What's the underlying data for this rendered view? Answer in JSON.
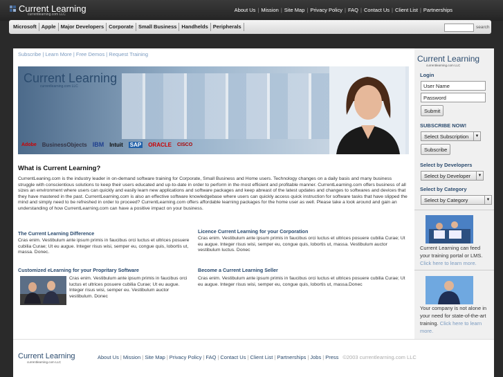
{
  "brand": {
    "name": "Current Learning",
    "sub": "currentlearning.com LLC"
  },
  "top_nav": [
    "About Us",
    "Mission",
    "Site Map",
    "Privacy Policy",
    "FAQ",
    "Contact Us",
    "Client List",
    "Partnerships"
  ],
  "menu": [
    "Microsoft",
    "Apple",
    "Major Developers",
    "Corporate",
    "Small Business",
    "Handhelds",
    "Peripherals"
  ],
  "search": {
    "button": "search"
  },
  "subnav": "Subscribe | Learn More | Free Demos | Request Training",
  "partners": [
    "Adobe",
    "BusinessObjects",
    "IBM",
    "Intuit",
    "SAP",
    "ORACLE",
    "CISCO"
  ],
  "main": {
    "heading": "What is Current Learning?",
    "intro": "CurrentLeaning.com is the industry leader in on-demand software training for Corporate, Small Business and Home users. Technology changes on a daily basis and many business struggle with conscientious solutions to keep their users educated and up-to-date in order to perform in the most efficient and profitable manner. CurrentLearning.com offers business of all sizes an environment where users can quickly and easily learn new applications and software packages and keep abreast of the latest updates and changes to softwares and devices that they have mastered in the past. CurrentLearning.com is also an effective software knowledgebase where users can quickly access quick instruction for software tasks that have slipped the mind and simply need to be refreshed in order to proceed? CurrentLearning.com offers affordable learning packages for the home user as well. Please take a look around and gain an understanding of how CurrentLearning.com can have a positive impact on your business.",
    "sections": [
      {
        "title": "The Current Learning Difference",
        "body": "Cras enim. Vestibulum ante ipsum primis in faucibus orci luctus et ultrices posuere cubilia Curae; Ut eu augue. Integer risus wisi, semper eu, congue quis, lobortis ut, massa. Donec."
      },
      {
        "title": "Licence Current Learning for your Corporation",
        "body": "Cras enim. Vestibulum ante ipsum primis in faucibus orci luctus et ultrices posuere cubilia Curae; Ut eu augue. Integer risus wisi, semper eu, congue quis, lobortis ut, massa. Vestibulum auctor vestibulum luctus. Donec"
      },
      {
        "title": "Customized eLearning for your Propritary Software",
        "body": "Cras enim. Vestibulum ante ipsum primis in faucibus orci luctus et ultrices posuere cubilia Curae; Ut eu augue. Integer risus wisi, semper eu. Vestibulum auctor vestibulum. Donec"
      },
      {
        "title": "Become a Current Learning Seller",
        "body": "Cras enim. Vestibulum ante ipsum primis in faucibus orci luctus et ultrices posuere cubilia Curae; Ut eu augue. Integer risus wisi, semper eu, congue quis, lobortis ut, massa.Donec"
      }
    ]
  },
  "sidebar": {
    "login_label": "Login",
    "username_value": "User Name",
    "password_value": "Password",
    "submit": "Submit",
    "subscribe_label": "SUBSCRIBE NOW!",
    "subscription_select": "Select Subscription",
    "subscribe_button": "Subscribe",
    "developers_label": "Select by Developers",
    "developer_select": "Select by Developer",
    "category_label": "Select by Category",
    "category_select": "Select by Category",
    "promo1": "Current Learning can feed your training portal or LMS.",
    "promo1_link": "Click here to learn more.",
    "promo2": "Your company is not alone in your need for state-of-the-art training.",
    "promo2_link": "Click here to learn more."
  },
  "footer": {
    "nav": [
      "About Us",
      "Mission",
      "Site Map",
      "Privacy Policy",
      "FAQ",
      "Contact Us",
      "Client List",
      "Partnerships",
      "Jobs",
      "Press"
    ],
    "copyright": "©2003 currentlearning.com LLC"
  },
  "colors": {
    "accent": "#2b4b6e",
    "link": "#7a9abf",
    "background": "#2a2a2a"
  }
}
